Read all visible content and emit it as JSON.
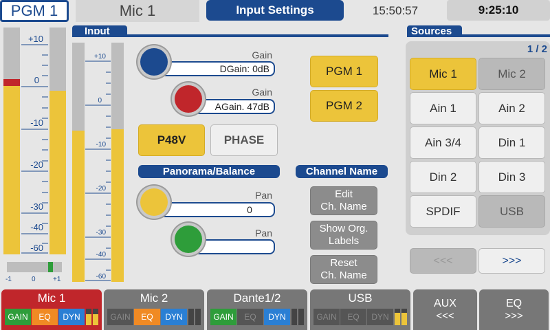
{
  "header": {
    "channel": "PGM 1",
    "input_name": "Mic 1",
    "page_title": "Input Settings",
    "clock1": "15:50:57",
    "clock2": "9:25:10"
  },
  "meter": {
    "ticks": [
      "+10",
      "0",
      "-10",
      "-20",
      "-30",
      "-40",
      "-60"
    ],
    "small_ticks": [
      "+10",
      "0",
      "-10",
      "-20",
      "-30",
      "-40",
      "-60"
    ],
    "balance_labels": [
      "-1",
      "0",
      "+1"
    ]
  },
  "input": {
    "title": "Input",
    "dgain_label": "Gain",
    "dgain_value": "DGain: 0dB",
    "again_label": "Gain",
    "again_value": "AGain. 47dB",
    "p48v": "P48V",
    "phase": "PHASE",
    "pgm1": "PGM 1",
    "pgm2": "PGM 2",
    "pan_title": "Panorama/Balance",
    "pan1_label": "Pan",
    "pan1_value": "0",
    "pan2_label": "Pan",
    "pan2_value": "",
    "chname_title": "Channel Name",
    "edit": "Edit\nCh. Name",
    "show": "Show Org.\nLabels",
    "reset": "Reset\nCh. Name"
  },
  "sources": {
    "title": "Sources",
    "page": "1 / 2",
    "items": [
      "Mic 1",
      "Mic 2",
      "Ain 1",
      "Ain 2",
      "Ain 3/4",
      "Din 1",
      "Din 2",
      "Din 3",
      "SPDIF",
      "USB"
    ],
    "prev": "<<<",
    "next": ">>>"
  },
  "bottom": {
    "tabs": [
      {
        "name": "Mic 1",
        "gain": "GAIN",
        "eq": "EQ",
        "dyn": "DYN"
      },
      {
        "name": "Mic 2",
        "gain": "GAIN",
        "eq": "EQ",
        "dyn": "DYN"
      },
      {
        "name": "Dante1/2",
        "gain": "GAIN",
        "eq": "EQ",
        "dyn": "DYN"
      },
      {
        "name": "USB",
        "gain": "GAIN",
        "eq": "EQ",
        "dyn": "DYN"
      }
    ],
    "aux_label": "AUX",
    "aux_arrow": "<<<",
    "eq_label": "EQ",
    "eq_arrow": ">>>"
  },
  "colors": {
    "accent": "#1c4a8f",
    "yellow": "#ecc43a",
    "red": "#c0262b",
    "green": "#2e9d3a"
  }
}
